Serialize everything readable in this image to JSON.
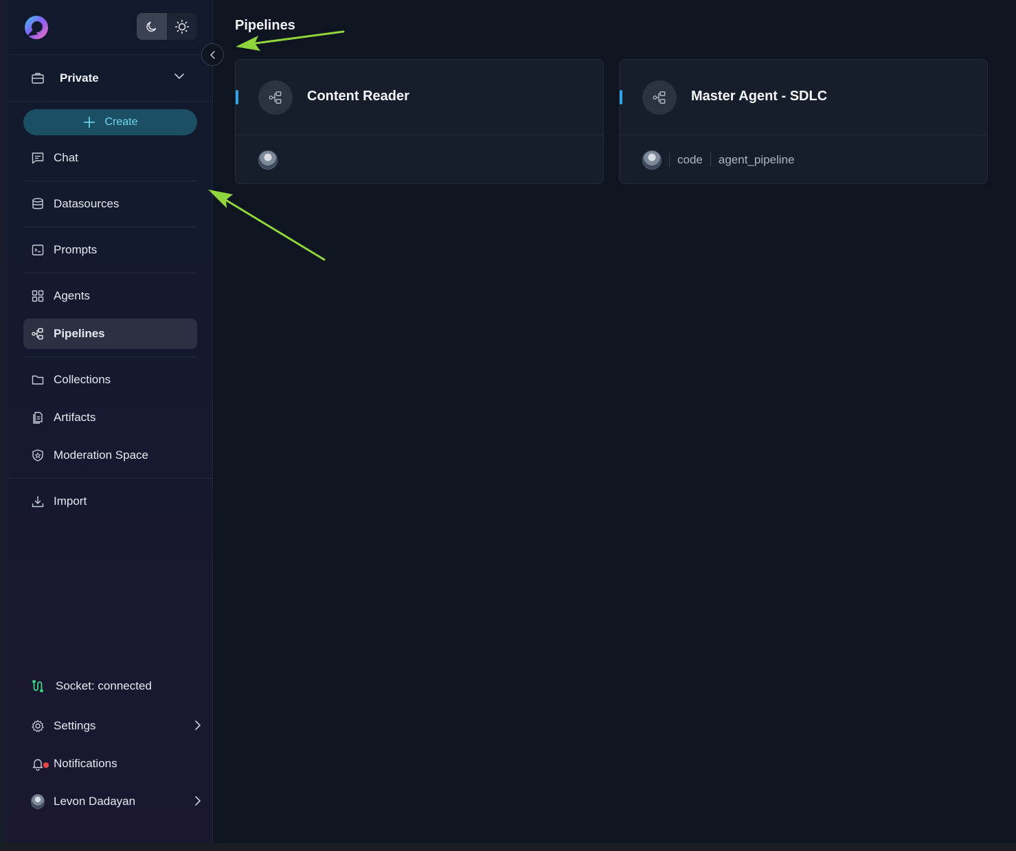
{
  "sidebar": {
    "workspace": "Private",
    "create_label": "Create",
    "nav": {
      "chat": "Chat",
      "datasources": "Datasources",
      "prompts": "Prompts",
      "agents": "Agents",
      "pipelines": "Pipelines",
      "collections": "Collections",
      "artifacts": "Artifacts",
      "moderation": "Moderation Space",
      "import": "Import"
    },
    "socket_status": "Socket: connected",
    "settings": "Settings",
    "notifications": "Notifications",
    "user_name": "Levon Dadayan",
    "active_item": "pipelines"
  },
  "main": {
    "title": "Pipelines",
    "cards": [
      {
        "name": "Content Reader",
        "tags": []
      },
      {
        "name": "Master Agent - SDLC",
        "tags": [
          "code",
          "agent_pipeline"
        ]
      }
    ]
  },
  "colors": {
    "accent": "#2ea3e6",
    "create_text": "#6fd8f2",
    "socket_icon": "#3ddc84",
    "annotation_arrow": "#8fd63c"
  },
  "icons": {
    "logo": "app-logo",
    "dark": "moon-icon",
    "light": "sun-icon"
  }
}
